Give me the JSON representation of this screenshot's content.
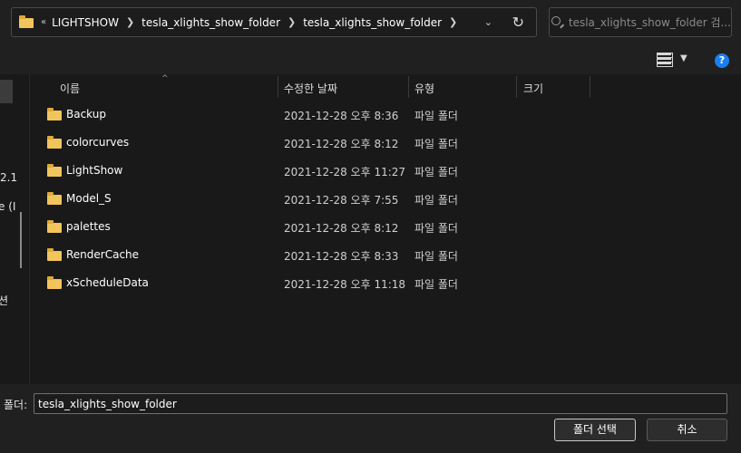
{
  "address_bar": {
    "lead": "«",
    "crumbs": [
      "LIGHTSHOW",
      "tesla_xlights_show_folder",
      "tesla_xlights_show_folder"
    ]
  },
  "search": {
    "placeholder": "tesla_xlights_show_folder 검..."
  },
  "nav_pane": {
    "fragments": [
      "2.1",
      "e (I",
      "션"
    ]
  },
  "columns": {
    "name": "이름",
    "date": "수정한 날짜",
    "type": "유형",
    "size": "크기"
  },
  "files": [
    {
      "name": "Backup",
      "date": "2021-12-28 오후 8:36",
      "type": "파일 폴더"
    },
    {
      "name": "colorcurves",
      "date": "2021-12-28 오후 8:12",
      "type": "파일 폴더"
    },
    {
      "name": "LightShow",
      "date": "2021-12-28 오후 11:27",
      "type": "파일 폴더"
    },
    {
      "name": "Model_S",
      "date": "2021-12-28 오후 7:55",
      "type": "파일 폴더"
    },
    {
      "name": "palettes",
      "date": "2021-12-28 오후 8:12",
      "type": "파일 폴더"
    },
    {
      "name": "RenderCache",
      "date": "2021-12-28 오후 8:33",
      "type": "파일 폴더"
    },
    {
      "name": "xScheduleData",
      "date": "2021-12-28 오후 11:18",
      "type": "파일 폴더"
    }
  ],
  "footer": {
    "folder_label": "폴더:",
    "folder_value": "tesla_xlights_show_folder",
    "select_button": "폴더 선택",
    "cancel_button": "취소"
  },
  "colors": {
    "accent": "#1a7ff0",
    "folder": "#f2c55c",
    "background": "#191919"
  }
}
